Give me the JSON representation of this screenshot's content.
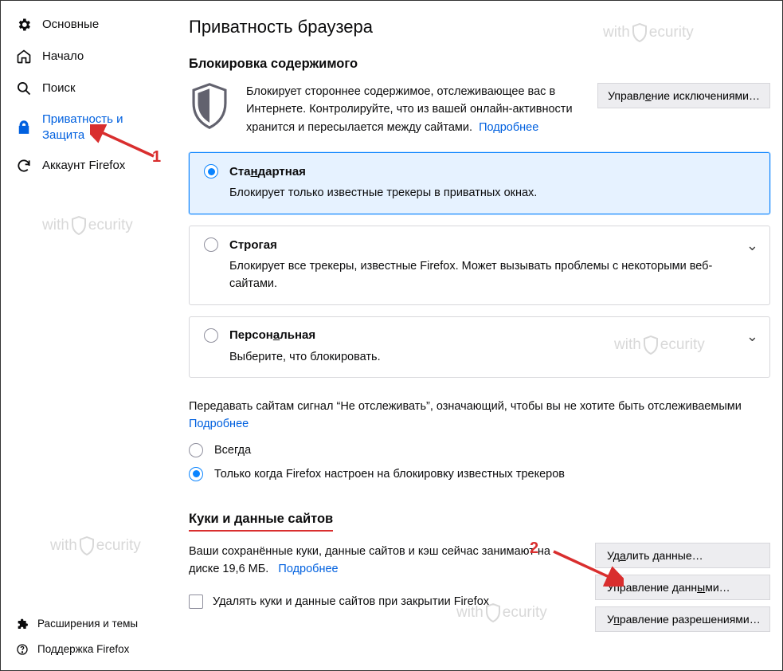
{
  "sidebar": {
    "items": [
      {
        "label": "Основные"
      },
      {
        "label": "Начало"
      },
      {
        "label": "Поиск"
      },
      {
        "label": "Приватность и Защита"
      },
      {
        "label": "Аккаунт Firefox"
      }
    ],
    "bottom": [
      {
        "label": "Расширения и темы"
      },
      {
        "label": "Поддержка Firefox"
      }
    ]
  },
  "page": {
    "title": "Приватность браузера",
    "content_blocking": {
      "heading": "Блокировка содержимого",
      "desc": "Блокирует стороннее содержимое, отслеживающее вас в Интернете. Контролируйте, что из вашей онлайн-активности хранится и пересылается между сайтами.",
      "more": "Подробнее",
      "exceptions_btn": "Управление исключениями…",
      "options": [
        {
          "title": "Стандартная",
          "title_ul": "н",
          "desc": "Блокирует только известные трекеры в приватных окнах.",
          "selected": true,
          "expandable": false
        },
        {
          "title": "Строгая",
          "title_ul": "",
          "desc": "Блокирует все трекеры, известные Firefox. Может вызывать проблемы с некоторыми веб-сайтами.",
          "selected": false,
          "expandable": true
        },
        {
          "title": "Персональная",
          "title_ul": "а",
          "desc": "Выберите, что блокировать.",
          "selected": false,
          "expandable": true
        }
      ]
    },
    "dnt": {
      "text": "Передавать сайтам сигнал “Не отслеживать”, означающий, чтобы вы не хотите быть отслеживаемыми",
      "more": "Подробнее",
      "opt_always": "Всегда",
      "opt_onlywhen": "Только когда Firefox настроен на блокировку известных трекеров",
      "selected": "onlywhen"
    },
    "cookies": {
      "heading": "Куки и данные сайтов",
      "desc_pre": "Ваши сохранённые куки, данные сайтов и кэш сейчас занимают на диске ",
      "size": "19,6 МБ",
      "desc_post": ".",
      "more": "Подробнее",
      "clear_chk": "Удалять куки и данные сайтов при закрытии Firefox",
      "btn_clear": "Удалить данные…",
      "btn_manage": "Управление данными…",
      "btn_perms": "Управление разрешениями…"
    }
  },
  "annotations": {
    "n1": "1",
    "n2": "2"
  },
  "watermark": {
    "pre": "with",
    "post": "ecurity"
  }
}
